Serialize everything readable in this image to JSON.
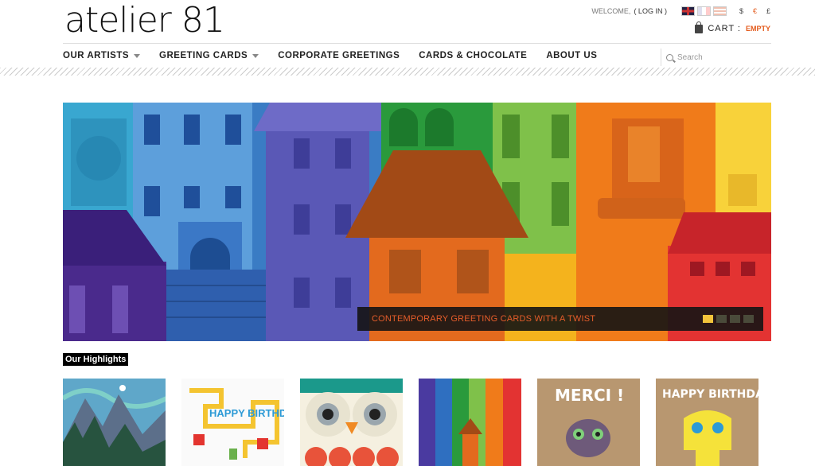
{
  "header": {
    "logo": "atelier 81",
    "welcome": "WELCOME,",
    "login": "( LOG IN )",
    "currencies": [
      "$",
      "€",
      "£"
    ],
    "cart_label": "CART :",
    "cart_status": "EMPTY"
  },
  "nav": {
    "items": [
      {
        "label": "OUR ARTISTS",
        "dropdown": true
      },
      {
        "label": "GREETING CARDS",
        "dropdown": true
      },
      {
        "label": "CORPORATE GREETINGS",
        "dropdown": false
      },
      {
        "label": "CARDS & CHOCOLATE",
        "dropdown": false
      },
      {
        "label": "ABOUT US",
        "dropdown": false
      }
    ],
    "search_placeholder": "Search"
  },
  "banner": {
    "caption": "CONTEMPORARY GREETING CARDS WITH A TWIST",
    "slides": 4,
    "active_slide": 1
  },
  "highlights": {
    "title": "Our Highlights",
    "cards": [
      {
        "name": "mountains-card"
      },
      {
        "name": "happy-birthday-board-card",
        "text": "HAPPY BIRTHDAY!"
      },
      {
        "name": "owl-card"
      },
      {
        "name": "rainbow-houses-card"
      },
      {
        "name": "merci-card",
        "text": "MERCI !"
      },
      {
        "name": "happy-birthday-robot-card",
        "text": "HAPPY BIRTHDAY"
      }
    ]
  },
  "colors": {
    "accent": "#e45b1c",
    "caption_text": "#e55d2a",
    "active_dot": "#f3c33b"
  }
}
